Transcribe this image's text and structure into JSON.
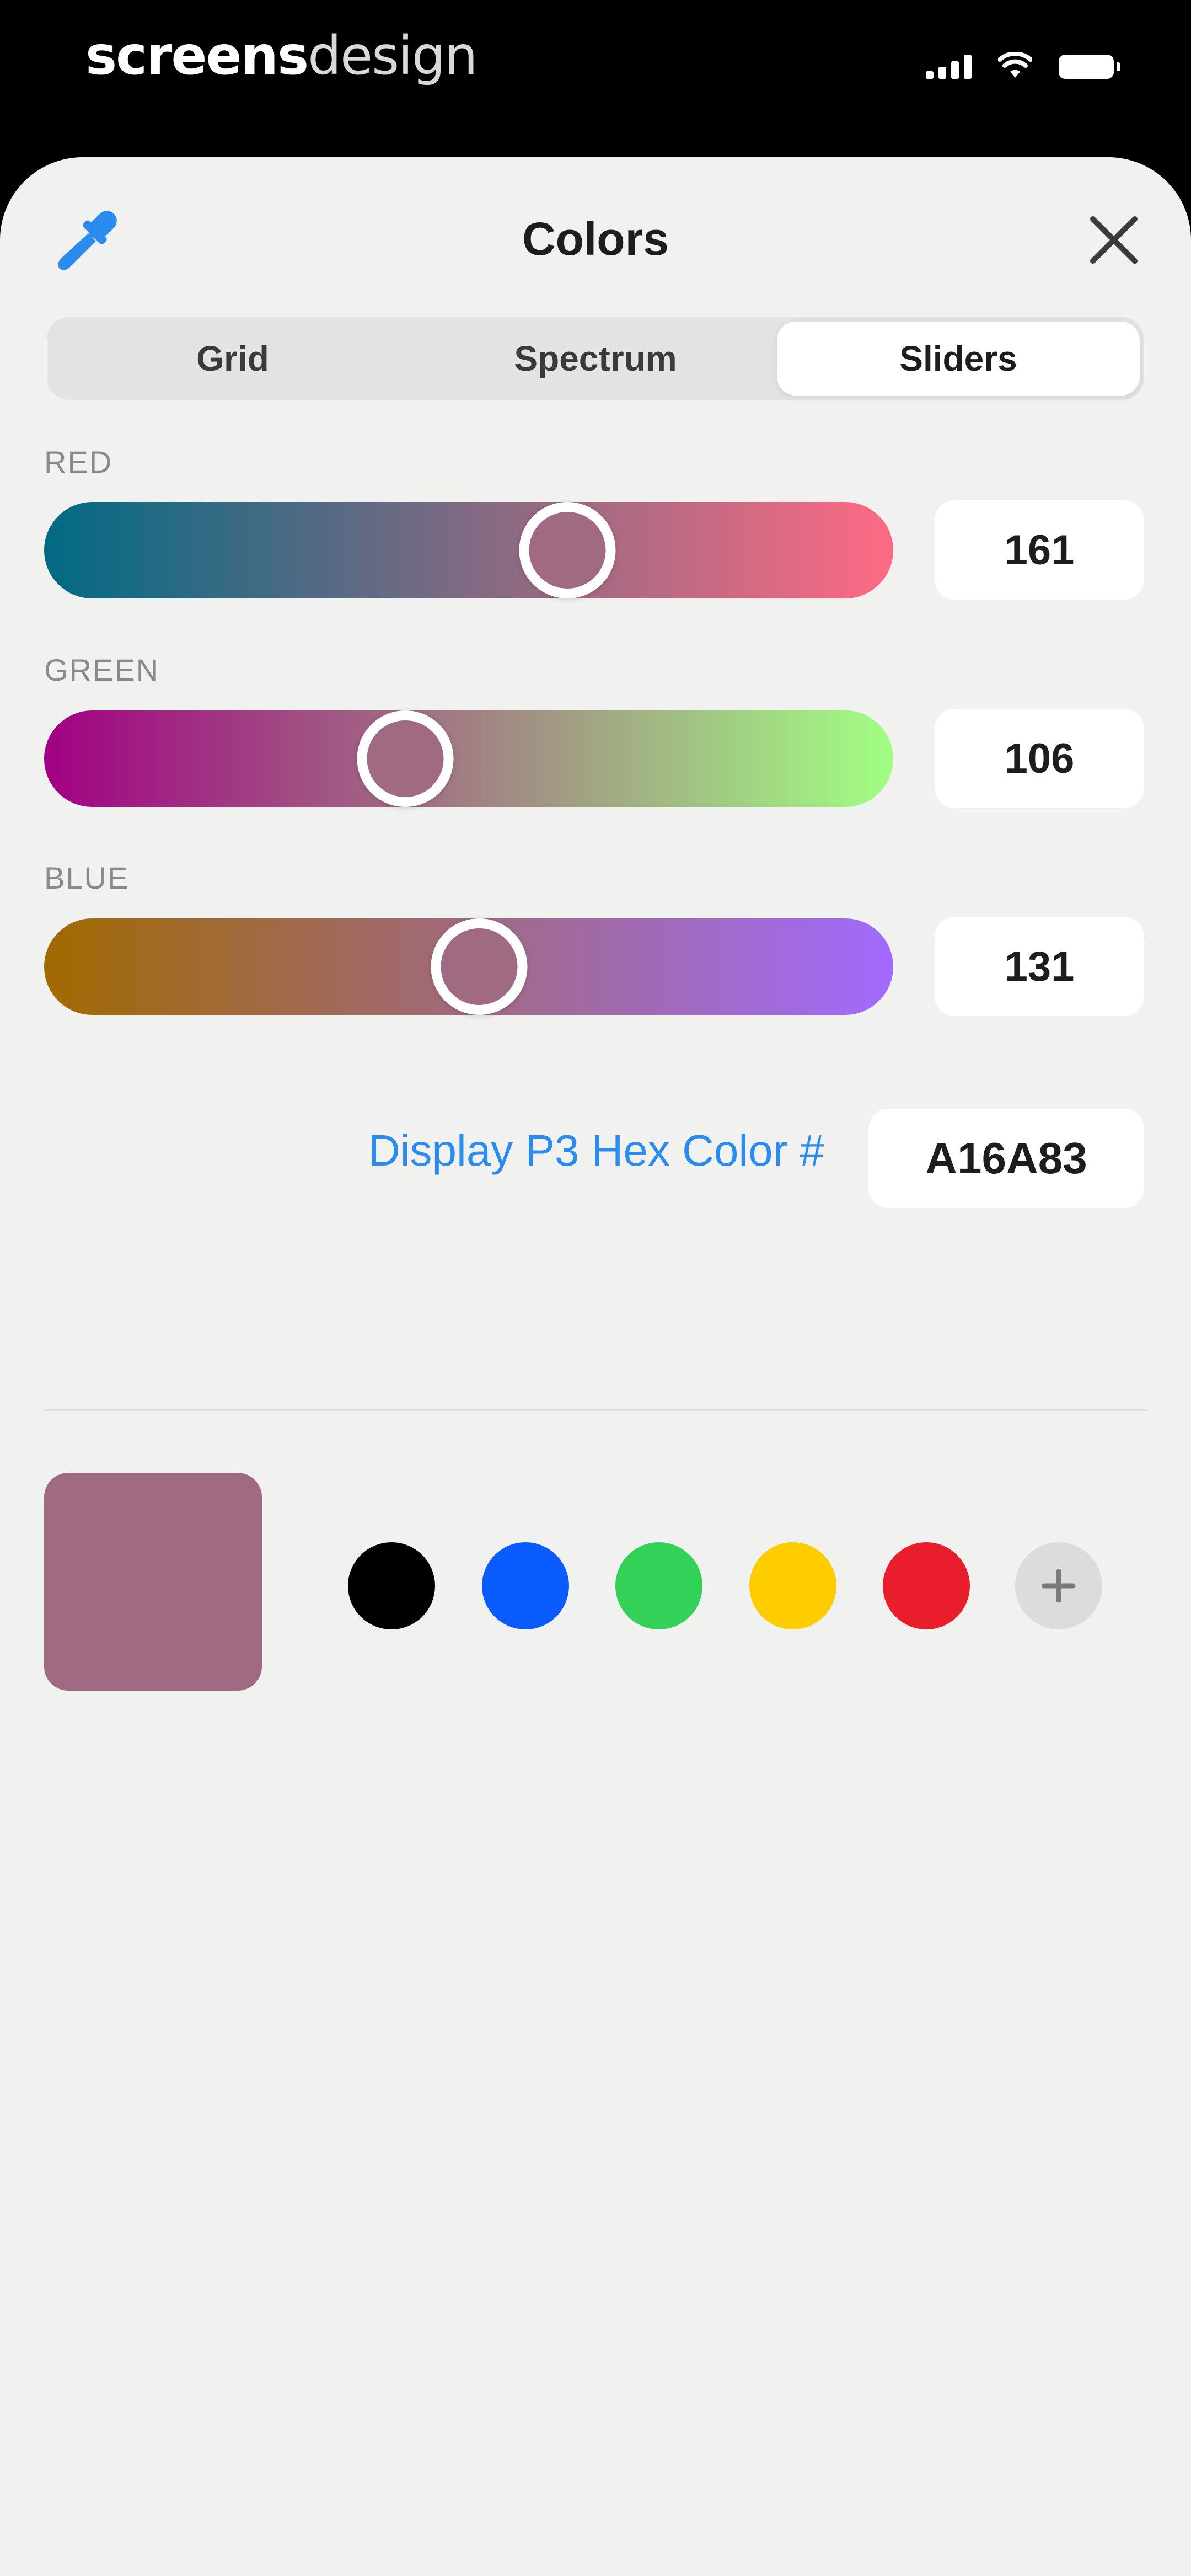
{
  "watermark": {
    "bold": "screens",
    "light": "design"
  },
  "header": {
    "title": "Colors",
    "eyedropper_icon": "eyedropper-icon",
    "close_icon": "close-icon",
    "accent_color": "#2b8cf0"
  },
  "tabs": [
    {
      "label": "Grid",
      "active": false
    },
    {
      "label": "Spectrum",
      "active": false
    },
    {
      "label": "Sliders",
      "active": true
    }
  ],
  "sliders": {
    "red": {
      "label": "RED",
      "value": "161",
      "gradient_start": "#006a83",
      "gradient_end": "#ff6a83"
    },
    "green": {
      "label": "GREEN",
      "value": "106",
      "gradient_start": "#a10083",
      "gradient_end": "#a1ff83"
    },
    "blue": {
      "label": "BLUE",
      "value": "131",
      "gradient_start": "#a16a00",
      "gradient_end": "#a16aff"
    }
  },
  "hex": {
    "label": "Display P3 Hex Color #",
    "value": "A16A83"
  },
  "current_color": "#a16a83",
  "presets": [
    {
      "name": "black-swatch",
      "color": "#000000"
    },
    {
      "name": "blue-swatch",
      "color": "#0b5cff"
    },
    {
      "name": "green-swatch",
      "color": "#34d158"
    },
    {
      "name": "yellow-swatch",
      "color": "#ffcc00"
    },
    {
      "name": "red-swatch",
      "color": "#ea1d2c"
    }
  ],
  "add_icon": "plus-icon"
}
